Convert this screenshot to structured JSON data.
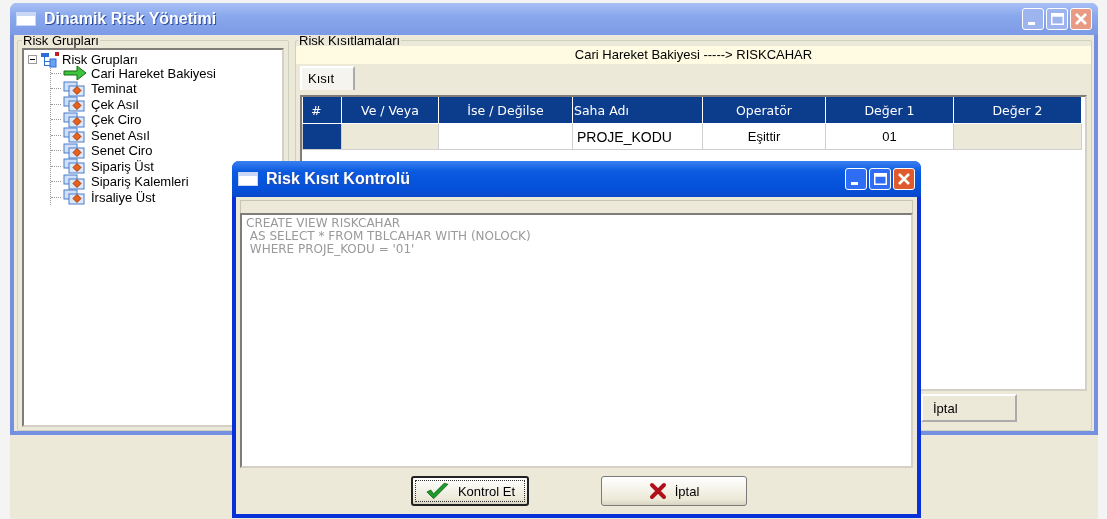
{
  "window": {
    "title": "Dinamik Risk Yönetimi",
    "active": false
  },
  "groups_panel": {
    "title": "Risk Grupları",
    "tree": [
      {
        "label": "Risk Grupları",
        "kind": "root",
        "expanded": true,
        "children": [
          {
            "label": "Cari Hareket Bakiyesi",
            "kind": "item",
            "selected": true
          },
          {
            "label": "Teminat",
            "kind": "item",
            "selected": false
          },
          {
            "label": "Çek Asıl",
            "kind": "item",
            "selected": false
          },
          {
            "label": "Çek Ciro",
            "kind": "item",
            "selected": false
          },
          {
            "label": "Senet Asıl",
            "kind": "item",
            "selected": false
          },
          {
            "label": "Senet Ciro",
            "kind": "item",
            "selected": false
          },
          {
            "label": "Sipariş Üst",
            "kind": "item",
            "selected": false
          },
          {
            "label": "Sipariş Kalemleri",
            "kind": "item",
            "selected": false
          },
          {
            "label": "İrsaliye Üst",
            "kind": "item",
            "selected": false
          }
        ]
      }
    ]
  },
  "restrictions_panel": {
    "title": "Risk Kısıtlamaları",
    "header": "Cari Hareket Bakiyesi -----> RISKCAHAR",
    "tabs": [
      {
        "label": "Kısıt",
        "selected": true
      }
    ],
    "table": {
      "columns": [
        "#",
        "Ve / Veya",
        "İse / Değilse",
        "Saha Adı",
        "Operatör",
        "Değer 1",
        "Değer 2"
      ],
      "rows": [
        {
          "cells": [
            null,
            null,
            null,
            "PROJE_KODU",
            "Eşittir",
            "01",
            null
          ]
        }
      ]
    },
    "buttons": [
      "İptal"
    ]
  },
  "dialog": {
    "title": "Risk Kısıt Kontrolü",
    "active": true,
    "sql_lines": [
      "CREATE VIEW RISKCAHAR",
      " AS SELECT * FROM TBLCAHAR WITH (NOLOCK)",
      " WHERE PROJE_KODU = '01'"
    ],
    "buttons": [
      {
        "label": "Kontrol Et",
        "kind": "check",
        "focused": true
      },
      {
        "label": "İptal",
        "kind": "cancel",
        "focused": false
      }
    ]
  }
}
